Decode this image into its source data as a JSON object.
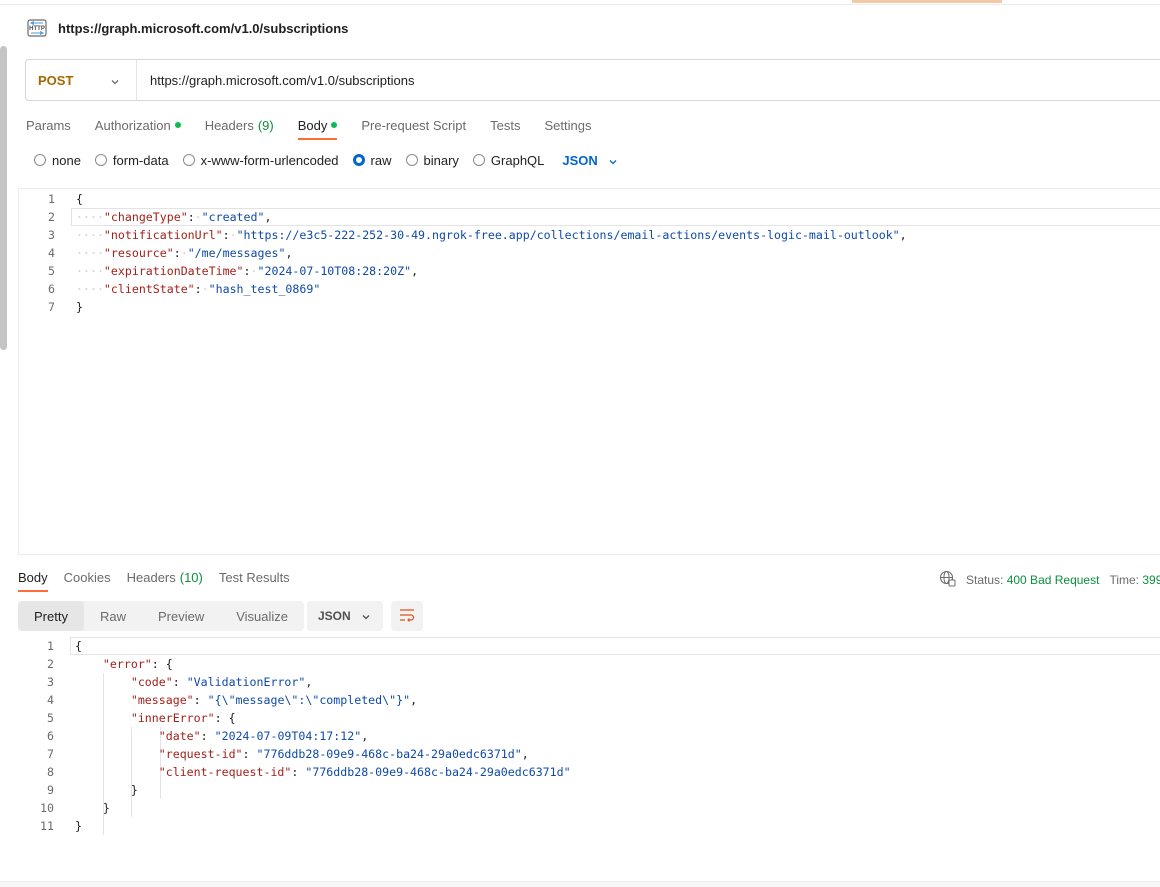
{
  "request": {
    "title": "https://graph.microsoft.com/v1.0/subscriptions",
    "method": "POST",
    "url": "https://graph.microsoft.com/v1.0/subscriptions"
  },
  "tabs": {
    "params": "Params",
    "authorization": "Authorization",
    "headers": "Headers",
    "headers_count": "(9)",
    "body": "Body",
    "prerequest": "Pre-request Script",
    "tests": "Tests",
    "settings": "Settings"
  },
  "body_modes": {
    "none": "none",
    "form_data": "form-data",
    "urlencoded": "x-www-form-urlencoded",
    "raw": "raw",
    "binary": "binary",
    "graphql": "GraphQL",
    "format": "JSON",
    "selected": "raw"
  },
  "request_body": {
    "line_numbers": [
      "1",
      "2",
      "3",
      "4",
      "5",
      "6",
      "7"
    ],
    "open": "{",
    "close": "}",
    "fields": [
      {
        "key": "\"changeType\"",
        "value": "\"created\"",
        "sep": ","
      },
      {
        "key": "\"notificationUrl\"",
        "value": "\"https://e3c5-222-252-30-49.ngrok-free.app/collections/email-actions/events-logic-mail-outlook\"",
        "sep": ","
      },
      {
        "key": "\"resource\"",
        "value": "\"/me/messages\"",
        "sep": ","
      },
      {
        "key": "\"expirationDateTime\"",
        "value": "\"2024-07-10T08:28:20Z\"",
        "sep": ","
      },
      {
        "key": "\"clientState\"",
        "value": "\"hash_test_0869\"",
        "sep": ""
      }
    ]
  },
  "response_tabs": {
    "body": "Body",
    "cookies": "Cookies",
    "headers": "Headers",
    "headers_count": "(10)",
    "test_results": "Test Results"
  },
  "response_status": {
    "status_label": "Status:",
    "status_value": "400 Bad Request",
    "time_label": "Time:",
    "time_value": "399"
  },
  "response_view": {
    "pretty": "Pretty",
    "raw": "Raw",
    "preview": "Preview",
    "visualize": "Visualize",
    "format": "JSON"
  },
  "response_body": {
    "line_numbers": [
      "1",
      "2",
      "3",
      "4",
      "5",
      "6",
      "7",
      "8",
      "9",
      "10",
      "11"
    ],
    "open": "{",
    "close": "}",
    "error_key": "\"error\"",
    "code_key": "\"code\"",
    "code_value": "\"ValidationError\"",
    "message_key": "\"message\"",
    "message_value": "\"{\\\"message\\\":\\\"completed\\\"}\"",
    "inner_key": "\"innerError\"",
    "date_key": "\"date\"",
    "date_value": "\"2024-07-09T04:17:12\"",
    "request_id_key": "\"request-id\"",
    "request_id_value": "\"776ddb28-09e9-468c-ba24-29a0edc6371d\"",
    "client_request_id_key": "\"client-request-id\"",
    "client_request_id_value": "\"776ddb28-09e9-468c-ba24-29a0edc6371d\""
  },
  "icons": {
    "request_type": "http-icon",
    "dropdown": "chevron-down-icon",
    "network": "globe-icon",
    "wrap": "wrap-lines-icon"
  },
  "colors": {
    "accent": "#ff6c37",
    "method_post": "#a36700",
    "selected_blue": "#0265d2",
    "success_green": "#0a8f3e",
    "json_key": "#a3221b",
    "json_string": "#0f4aa8"
  }
}
